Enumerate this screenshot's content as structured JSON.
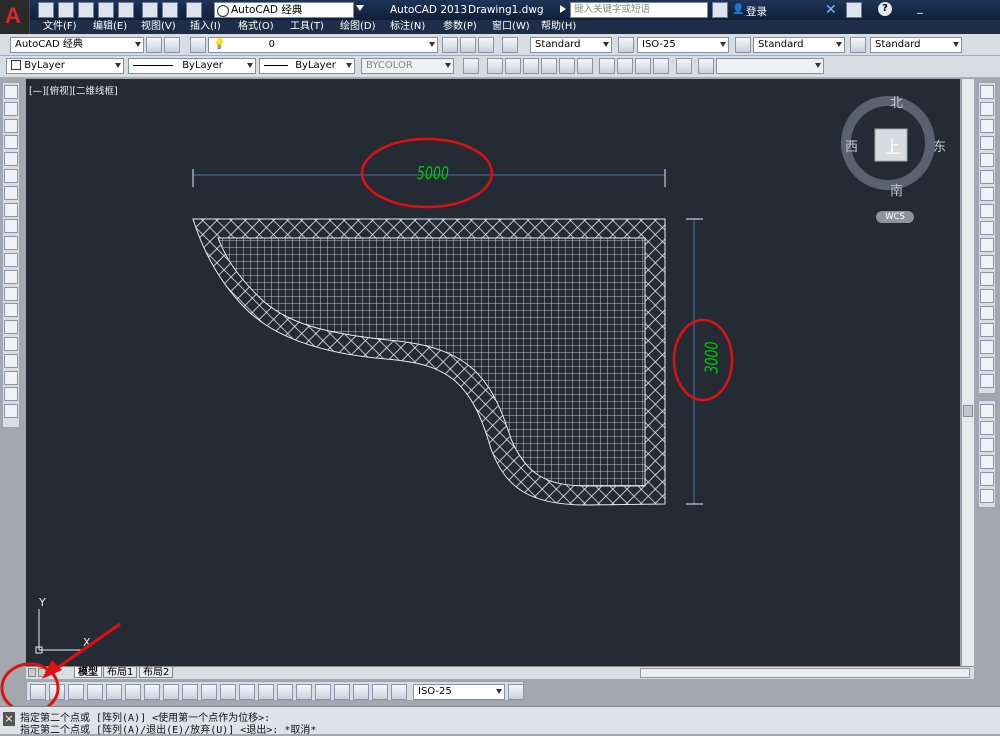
{
  "title_bar": {
    "app_name": "AutoCAD 2013",
    "document": "Drawing1.dwg",
    "workspace": "AutoCAD 经典",
    "search_placeholder": "键入关键字或短语",
    "login_label": "登录"
  },
  "menu": [
    "文件(F)",
    "编辑(E)",
    "视图(V)",
    "插入(I)",
    "格式(O)",
    "工具(T)",
    "绘图(D)",
    "标注(N)",
    "参数(P)",
    "窗口(W)",
    "帮助(H)"
  ],
  "toolbar1": {
    "workspace_combo": "AutoCAD 经典",
    "layer_combo": "0",
    "text_style": "Standard",
    "dim_style": "ISO-25",
    "table_style": "Standard",
    "multileader_style": "Standard"
  },
  "toolbar2": {
    "color": "ByLayer",
    "linetype": "ByLayer",
    "lineweight": "ByLayer",
    "plot_style": "BYCOLOR"
  },
  "viewport": {
    "label": "[—][俯视][二维线框]",
    "dimension_horizontal": "5000",
    "dimension_vertical": "3000",
    "ucs_x": "X",
    "ucs_y": "Y"
  },
  "viewcube": {
    "north": "北",
    "south": "南",
    "east": "东",
    "west": "西",
    "face": "上",
    "wcs": "WCS"
  },
  "tabs": [
    "模型",
    "布局1",
    "布局2"
  ],
  "dim_toolbar": {
    "style_combo": "ISO-25"
  },
  "command_line": [
    "指定第二个点或 [阵列(A)] <使用第一个点作为位移>:",
    "指定第二个点或 [阵列(A)/退出(E)/放弃(U)] <退出>: *取消*"
  ],
  "colors": {
    "canvas": "#252b35",
    "dimension_text": "#00c800",
    "dimension_line": "#4a6fa8",
    "annotation_circle": "#e01010",
    "hatch": "#e8ecf0"
  }
}
